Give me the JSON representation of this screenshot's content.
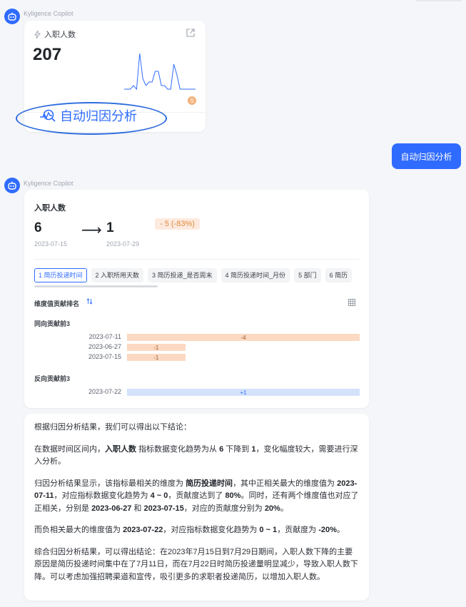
{
  "sender": "Kyligence Copilot",
  "metric_card": {
    "title": "入职人数",
    "value": "207",
    "badge": "S",
    "sparkline": [
      0,
      0,
      0,
      1,
      0,
      10,
      3,
      1,
      2,
      2,
      5,
      5,
      1,
      1,
      0,
      0,
      7,
      4,
      0,
      0,
      0,
      0,
      0,
      0
    ],
    "attr_button": "自动归因分析"
  },
  "user_message": "自动归因分析",
  "analysis": {
    "title": "入职人数",
    "from_value": "6",
    "to_value": "1",
    "arrow": "⟶",
    "from_date": "2023-07-15",
    "to_date": "2023-07-29",
    "change": "- 5 (-83%)",
    "tabs": [
      "1 简历投递时间",
      "2 入职所用天数",
      "3 简历投递_是否周末",
      "4 简历投递时间_月份",
      "5 部门",
      "6 简历"
    ],
    "rank_title": "维度值贡献排名",
    "same_title": "同向贡献前3",
    "reverse_title": "反向贡献前3",
    "same_rows": [
      {
        "date": "2023-07-11",
        "value": -4,
        "label": "-4"
      },
      {
        "date": "2023-06-27",
        "value": -1,
        "label": "-1"
      },
      {
        "date": "2023-07-15",
        "value": -1,
        "label": "-1"
      }
    ],
    "reverse_rows": [
      {
        "date": "2023-07-22",
        "value": 1,
        "label": "+1"
      }
    ]
  },
  "conclusion": {
    "intro": "根据归因分析结果，我们可以得出以下结论：",
    "p1": [
      "在数据时间区间内，",
      "入职人数",
      " 指标数据变化趋势为从 ",
      "6",
      " 下降到 ",
      "1",
      "，变化幅度较大，需要进行深入分析。"
    ],
    "p2": [
      "归因分析结果显示，该指标最相关的维度为 ",
      "简历投递时间",
      "，其中正相关最大的维度值为 ",
      "2023-07-11",
      "，对应指标数据变化趋势为 ",
      "4 ~ 0",
      "，贡献度达到了 ",
      "80%",
      "。同时，还有两个维度值也对应了正相关，分别是 ",
      "2023-06-27",
      " 和 ",
      "2023-07-15",
      "，对应的贡献度分别为 ",
      "20%",
      "。"
    ],
    "p3": [
      "而负相关最大的维度值为 ",
      "2023-07-22",
      "，对应指标数据变化趋势为 ",
      "0 ~ 1",
      "，贡献度为 ",
      "-20%",
      "。"
    ],
    "p4": "综合归因分析结果，可以得出结论：在2023年7月15日到7月29日期间，入职人数下降的主要原因是简历投递时间集中在了7月11日，而在7月22日时简历投递量明显减少，导致入职人数下降。可以考虑加强招聘渠道和宣传，吸引更多的求职者投递简历，以增加入职人数。"
  }
}
